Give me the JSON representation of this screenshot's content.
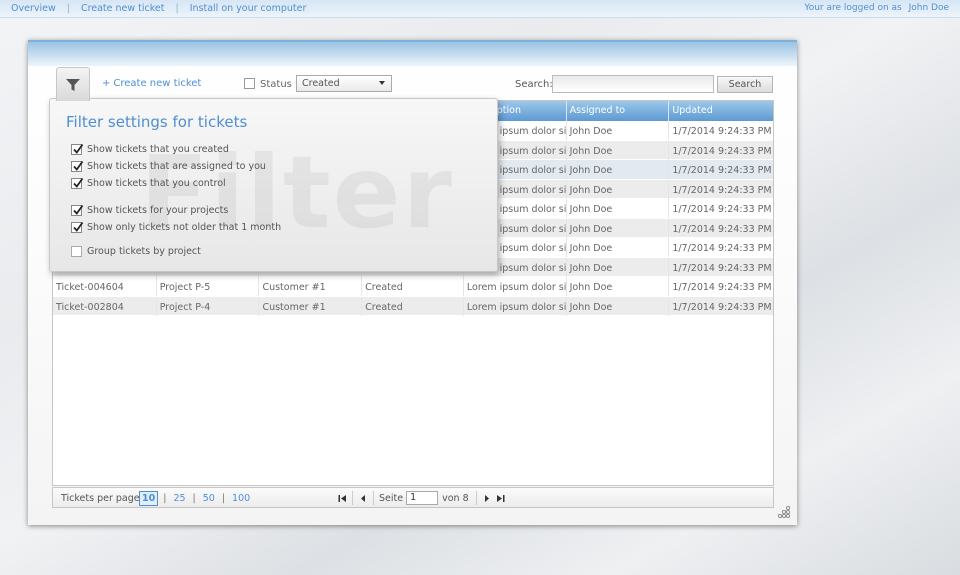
{
  "topnav": {
    "links": [
      "Overview",
      "Create new ticket",
      "Install on your computer"
    ],
    "separator": "|",
    "logged_text": "Your are logged on as",
    "user": "John Doe"
  },
  "toolbar": {
    "create_label": "Create new ticket",
    "create_prefix": "+",
    "status_label": "Status",
    "status_checked": false,
    "status_selected": "Created",
    "search_label": "Search:",
    "search_value": "",
    "search_button": "Search"
  },
  "grid": {
    "columns": [
      "",
      "",
      "",
      "",
      "Description",
      "Assigned to",
      "Updated"
    ],
    "rows": [
      [
        "",
        "",
        "",
        "",
        "Lorem ipsum dolor sit",
        "John Doe",
        "1/7/2014 9:24:33 PM"
      ],
      [
        "",
        "",
        "",
        "",
        "Lorem ipsum dolor sit",
        "John Doe",
        "1/7/2014 9:24:33 PM"
      ],
      [
        "",
        "",
        "",
        "",
        "Lorem ipsum dolor sit",
        "John Doe",
        "1/7/2014 9:24:33 PM"
      ],
      [
        "",
        "",
        "",
        "",
        "Lorem ipsum dolor sit",
        "John Doe",
        "1/7/2014 9:24:33 PM"
      ],
      [
        "",
        "",
        "",
        "",
        "Lorem ipsum dolor sit",
        "John Doe",
        "1/7/2014 9:24:33 PM"
      ],
      [
        "",
        "",
        "",
        "",
        "Lorem ipsum dolor sit",
        "John Doe",
        "1/7/2014 9:24:33 PM"
      ],
      [
        "",
        "",
        "",
        "",
        "Lorem ipsum dolor sit",
        "John Doe",
        "1/7/2014 9:24:33 PM"
      ],
      [
        "",
        "",
        "",
        "",
        "Lorem ipsum dolor sit",
        "John Doe",
        "1/7/2014 9:24:33 PM"
      ],
      [
        "Ticket-004604",
        "Project P-5",
        "Customer #1",
        "Created",
        "Lorem ipsum dolor sit",
        "John Doe",
        "1/7/2014 9:24:33 PM"
      ],
      [
        "Ticket-002804",
        "Project P-4",
        "Customer #1",
        "Created",
        "Lorem ipsum dolor sit",
        "John Doe",
        "1/7/2014 9:24:33 PM"
      ]
    ]
  },
  "pager": {
    "per_page_label": "Tickets per page",
    "sizes": [
      "10",
      "25",
      "50",
      "100"
    ],
    "active_size": "10",
    "size_separator": "|",
    "page_label": "Seite",
    "page_value": "1",
    "of_label": "von 8"
  },
  "filter": {
    "title": "Filter settings for tickets",
    "watermark": "Filter",
    "options": [
      {
        "label": "Show tickets that you created",
        "checked": true
      },
      {
        "label": "Show tickets that are assigned to you",
        "checked": true
      },
      {
        "label": "Show tickets that you control",
        "checked": true
      },
      {
        "label": "Show tickets for your projects",
        "checked": true
      },
      {
        "label": "Show only tickets not older that 1 month",
        "checked": true
      },
      {
        "label": "Group tickets by project",
        "checked": false
      }
    ]
  },
  "colors": {
    "link": "#4f8fd1",
    "header_blue": "#5d9ad2",
    "row_alt": "#ececec"
  }
}
